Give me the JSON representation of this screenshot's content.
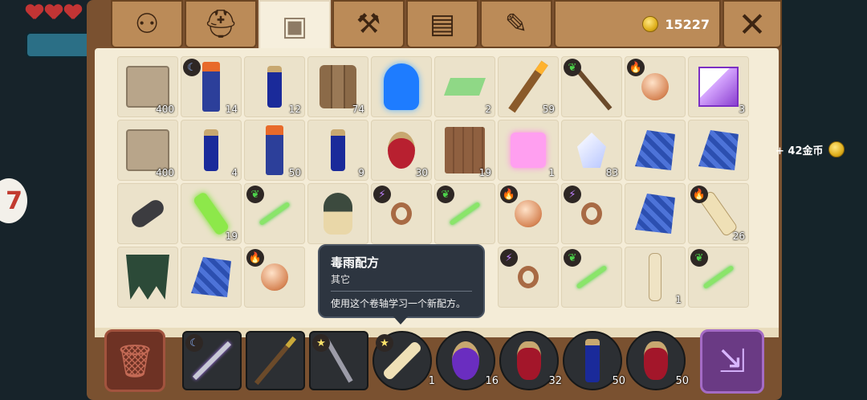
{
  "hud": {
    "hearts": 3,
    "side_badge": "7"
  },
  "tabs": [
    {
      "name": "hierarchy",
      "icon": "hierarchy-icon",
      "glyph": "⚇"
    },
    {
      "name": "equipment",
      "icon": "helmet-icon",
      "glyph": "⛑"
    },
    {
      "name": "inventory",
      "icon": "backpack-icon",
      "glyph": "▣",
      "active": true
    },
    {
      "name": "crafting",
      "icon": "hammer-icon",
      "glyph": "⚒"
    },
    {
      "name": "map",
      "icon": "map-icon",
      "glyph": "▤"
    },
    {
      "name": "quests",
      "icon": "scroll-icon",
      "glyph": "✎"
    }
  ],
  "currency": {
    "coins": "15227"
  },
  "reward_popup": {
    "text": "+ 42金币"
  },
  "inventory": [
    {
      "icon": "stone-block",
      "qty": "400"
    },
    {
      "icon": "totem",
      "badge": "moon",
      "qty": "14"
    },
    {
      "icon": "blue-bottle",
      "qty": "12"
    },
    {
      "icon": "wood-logs",
      "qty": "74"
    },
    {
      "icon": "blue-hero-figure",
      "qty": ""
    },
    {
      "icon": "green-gem",
      "qty": "2"
    },
    {
      "icon": "torch",
      "qty": "59"
    },
    {
      "icon": "nature-staff",
      "badge": "leaf",
      "qty": ""
    },
    {
      "icon": "fire-orb",
      "badge": "fire",
      "qty": ""
    },
    {
      "icon": "purple-cube",
      "qty": "3"
    },
    {
      "icon": "stone-block",
      "qty": "400"
    },
    {
      "icon": "blue-potion-jar",
      "qty": "4"
    },
    {
      "icon": "totem",
      "qty": "50"
    },
    {
      "icon": "blue-bottle",
      "qty": "9"
    },
    {
      "icon": "red-bottle",
      "qty": "30"
    },
    {
      "icon": "wooden-crate",
      "qty": "19"
    },
    {
      "icon": "pink-cube",
      "qty": "1"
    },
    {
      "icon": "crystal",
      "qty": "83"
    },
    {
      "icon": "blue-cloth",
      "qty": ""
    },
    {
      "icon": "blue-cloth",
      "qty": ""
    },
    {
      "icon": "bomb",
      "qty": ""
    },
    {
      "icon": "green-scroll",
      "qty": "19"
    },
    {
      "icon": "green-sword",
      "badge": "leaf",
      "qty": ""
    },
    {
      "icon": "mage-figure",
      "qty": ""
    },
    {
      "icon": "ring",
      "badge": "bolt",
      "qty": ""
    },
    {
      "icon": "green-sword",
      "badge": "leaf",
      "qty": ""
    },
    {
      "icon": "fire-orb",
      "badge": "fire",
      "qty": ""
    },
    {
      "icon": "ring",
      "badge": "bolt",
      "qty": ""
    },
    {
      "icon": "blue-cloth",
      "qty": ""
    },
    {
      "icon": "fire-scroll",
      "badge": "fire",
      "qty": "26"
    },
    {
      "icon": "green-banner",
      "qty": ""
    },
    {
      "icon": "blue-cloth",
      "qty": ""
    },
    {
      "icon": "fire-orb",
      "badge": "fire",
      "qty": ""
    },
    {
      "icon": "hidden",
      "qty": ""
    },
    {
      "icon": "hidden",
      "qty": ""
    },
    {
      "icon": "hidden",
      "qty": ""
    },
    {
      "icon": "ring",
      "badge": "bolt",
      "qty": ""
    },
    {
      "icon": "green-sword",
      "badge": "leaf",
      "qty": ""
    },
    {
      "icon": "plain-scroll",
      "qty": "1"
    },
    {
      "icon": "green-sword",
      "badge": "leaf",
      "qty": ""
    }
  ],
  "tooltip": {
    "title": "毒雨配方",
    "category": "其它",
    "description": "使用这个卷轴学习一个新配方。"
  },
  "hotbar": [
    {
      "icon": "purple-sword",
      "badge": "moon",
      "qty": "",
      "shape": "square"
    },
    {
      "icon": "pickaxe",
      "qty": "",
      "shape": "square"
    },
    {
      "icon": "star-wand",
      "badge": "star",
      "qty": "",
      "shape": "square"
    },
    {
      "icon": "recipe-scroll",
      "badge": "star",
      "qty": "1",
      "shape": "round"
    },
    {
      "icon": "purple-potion",
      "qty": "16",
      "shape": "round"
    },
    {
      "icon": "red-potion",
      "qty": "32",
      "shape": "round"
    },
    {
      "icon": "blue-potion",
      "qty": "50",
      "shape": "round"
    },
    {
      "icon": "red-potion",
      "qty": "50",
      "shape": "round"
    }
  ],
  "icons": {
    "trash": "trash-icon",
    "confirm": "exit-arrow-icon",
    "close": "close-icon"
  },
  "colors": {
    "panel": "#7a5130",
    "sheet": "#f4ecd7",
    "tab": "#bb8b58",
    "tooltip": "#2d3540"
  }
}
